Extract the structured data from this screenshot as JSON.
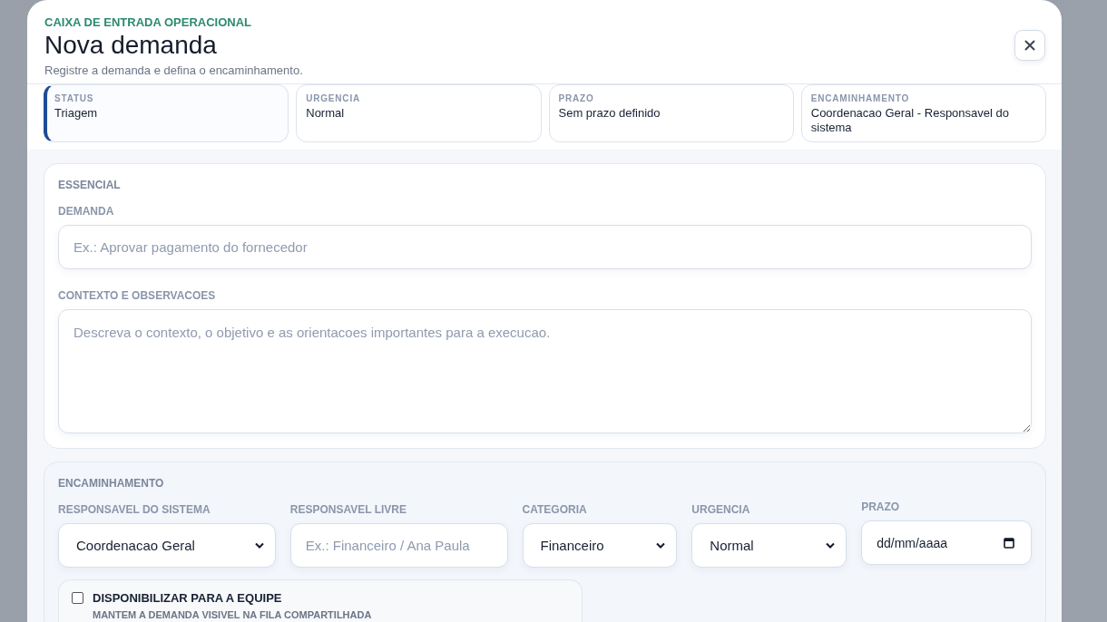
{
  "header": {
    "eyebrow": "CAIXA DE ENTRADA OPERACIONAL",
    "title": "Nova demanda",
    "subtitle": "Registre a demanda e defina o encaminhamento."
  },
  "summary": [
    {
      "label": "STATUS",
      "value": "Triagem",
      "selected": true
    },
    {
      "label": "URGENCIA",
      "value": "Normal",
      "selected": false
    },
    {
      "label": "PRAZO",
      "value": "Sem prazo definido",
      "selected": false
    },
    {
      "label": "ENCAMINHAMENTO",
      "value": "Coordenacao Geral - Responsavel do sistema",
      "selected": false
    }
  ],
  "essential": {
    "title": "ESSENCIAL",
    "fields": [
      {
        "label": "DEMANDA",
        "kind": "input",
        "placeholder": "Ex.: Aprovar pagamento do fornecedor"
      },
      {
        "label": "CONTEXTO E OBSERVACOES",
        "kind": "textarea",
        "placeholder": "Descreva o contexto, o objetivo e as orientacoes importantes para a execucao."
      }
    ]
  },
  "routing": {
    "title": "ENCAMINHAMENTO",
    "fields": [
      {
        "label": "RESPONSAVEL DO SISTEMA",
        "kind": "select",
        "value": "Coordenacao Geral"
      },
      {
        "label": "RESPONSAVEL LIVRE",
        "kind": "input",
        "placeholder": "Ex.: Financeiro / Ana Paula"
      },
      {
        "label": "CATEGORIA",
        "kind": "select",
        "value": "Financeiro"
      },
      {
        "label": "URGENCIA",
        "kind": "select",
        "value": "Normal"
      },
      {
        "label": "PRAZO",
        "kind": "date",
        "value": "dd/mm/aaaa"
      }
    ],
    "share": {
      "label": "DISPONIBILIZAR PARA A EQUIPE",
      "hint": "MANTEM A DEMANDA VISIVEL NA FILA COMPARTILHADA",
      "checked": false
    }
  }
}
